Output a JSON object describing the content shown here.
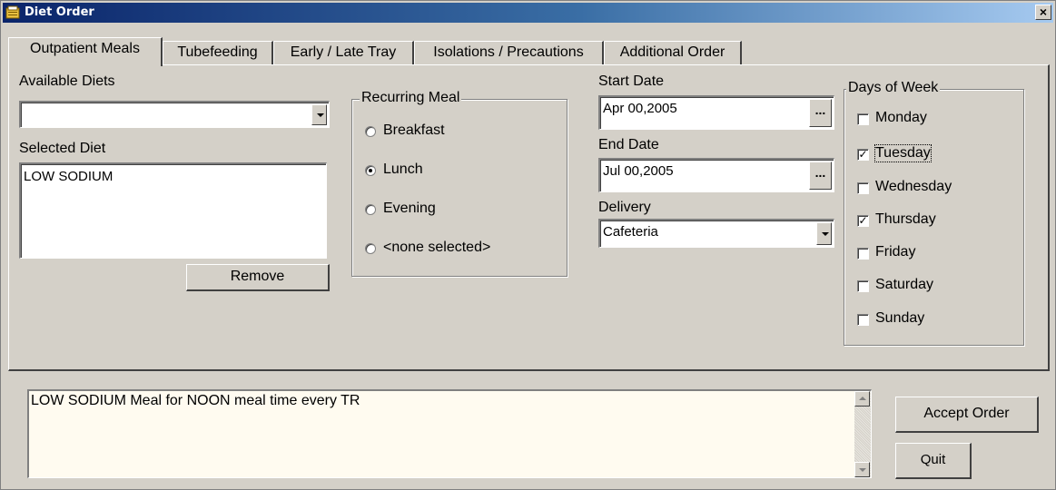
{
  "window": {
    "title": "Diet Order",
    "close_label": "×"
  },
  "tabs": [
    {
      "label": "Outpatient Meals",
      "active": true
    },
    {
      "label": "Tubefeeding",
      "active": false
    },
    {
      "label": "Early / Late Tray",
      "active": false
    },
    {
      "label": "Isolations / Precautions",
      "active": false
    },
    {
      "label": "Additional Order",
      "active": false
    }
  ],
  "diets": {
    "available_label": "Available Diets",
    "available_value": "",
    "selected_label": "Selected Diet",
    "selected_items": [
      "LOW SODIUM"
    ],
    "remove_label": "Remove"
  },
  "recurring": {
    "label": "Recurring Meal",
    "options": [
      {
        "label": "Breakfast",
        "selected": false
      },
      {
        "label": "Lunch",
        "selected": true
      },
      {
        "label": "Evening",
        "selected": false
      },
      {
        "label": "<none selected>",
        "selected": false
      }
    ]
  },
  "dates": {
    "start_label": "Start Date",
    "start_value": "Apr 00,2005",
    "end_label": "End Date",
    "end_value": "Jul 00,2005",
    "ellipsis": "...",
    "delivery_label": "Delivery",
    "delivery_value": "Cafeteria"
  },
  "days": {
    "label": "Days of Week",
    "items": [
      {
        "label": "Monday",
        "checked": false
      },
      {
        "label": "Tuesday",
        "checked": true
      },
      {
        "label": "Wednesday",
        "checked": false
      },
      {
        "label": "Thursday",
        "checked": true
      },
      {
        "label": "Friday",
        "checked": false
      },
      {
        "label": "Saturday",
        "checked": false
      },
      {
        "label": "Sunday",
        "checked": false
      }
    ]
  },
  "summary": {
    "text": "LOW SODIUM Meal for NOON meal time every TR"
  },
  "actions": {
    "accept_label": "Accept Order",
    "quit_label": "Quit"
  },
  "colors": {
    "titlebar_start": "#0a246a",
    "titlebar_end": "#a6caf0",
    "face": "#d4d0c8",
    "memo_bg": "#fffbf0"
  }
}
